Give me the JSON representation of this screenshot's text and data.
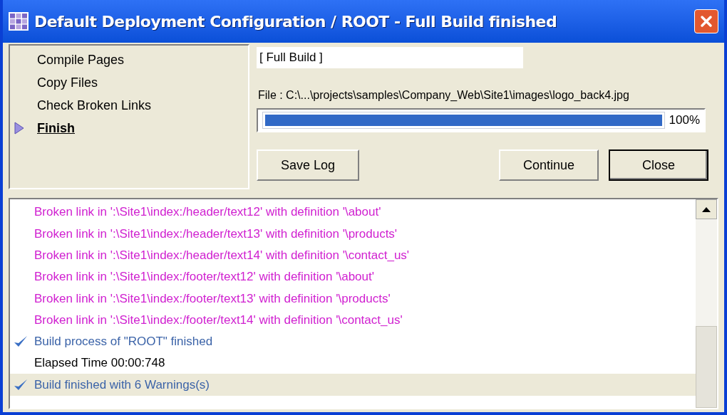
{
  "window": {
    "title": "Default Deployment Configuration / ROOT - Full Build finished"
  },
  "steps": [
    {
      "label": "Compile Pages",
      "current": false
    },
    {
      "label": "Copy Files",
      "current": false
    },
    {
      "label": "Check Broken Links",
      "current": false
    },
    {
      "label": "Finish",
      "current": true
    }
  ],
  "build_type": {
    "value": "[ Full Build ]"
  },
  "file_label": "File : C:\\...\\projects\\samples\\Company_Web\\Site1\\images\\logo_back4.jpg",
  "progress": {
    "level": 1,
    "reading": "100%"
  },
  "buttons": [
    {
      "label": "Save Log",
      "default": false
    },
    {
      "label": "Continue",
      "default": false
    },
    {
      "label": "Close",
      "default": true
    }
  ],
  "log": [
    {
      "kind": "warning",
      "text": "Broken link in ':\\Site1\\index:/header/text12' with definition '\\about'",
      "selected": false
    },
    {
      "kind": "warning",
      "text": "Broken link in ':\\Site1\\index:/header/text13' with definition '\\products'",
      "selected": false
    },
    {
      "kind": "warning",
      "text": "Broken link in ':\\Site1\\index:/header/text14' with definition '\\contact_us'",
      "selected": false
    },
    {
      "kind": "warning",
      "text": "Broken link in ':\\Site1\\index:/footer/text12' with definition '\\about'",
      "selected": false
    },
    {
      "kind": "warning",
      "text": "Broken link in ':\\Site1\\index:/footer/text13' with definition '\\products'",
      "selected": false
    },
    {
      "kind": "warning",
      "text": "Broken link in ':\\Site1\\index:/footer/text14' with definition '\\contact_us'",
      "selected": false
    },
    {
      "kind": "success",
      "text": "Build process of \"ROOT\" finished",
      "selected": false
    },
    {
      "kind": "info",
      "text": "Elapsed Time 00:00:748",
      "selected": false
    },
    {
      "kind": "success",
      "text": "Build finished with 6 Warnings(s)",
      "selected": true
    }
  ]
}
